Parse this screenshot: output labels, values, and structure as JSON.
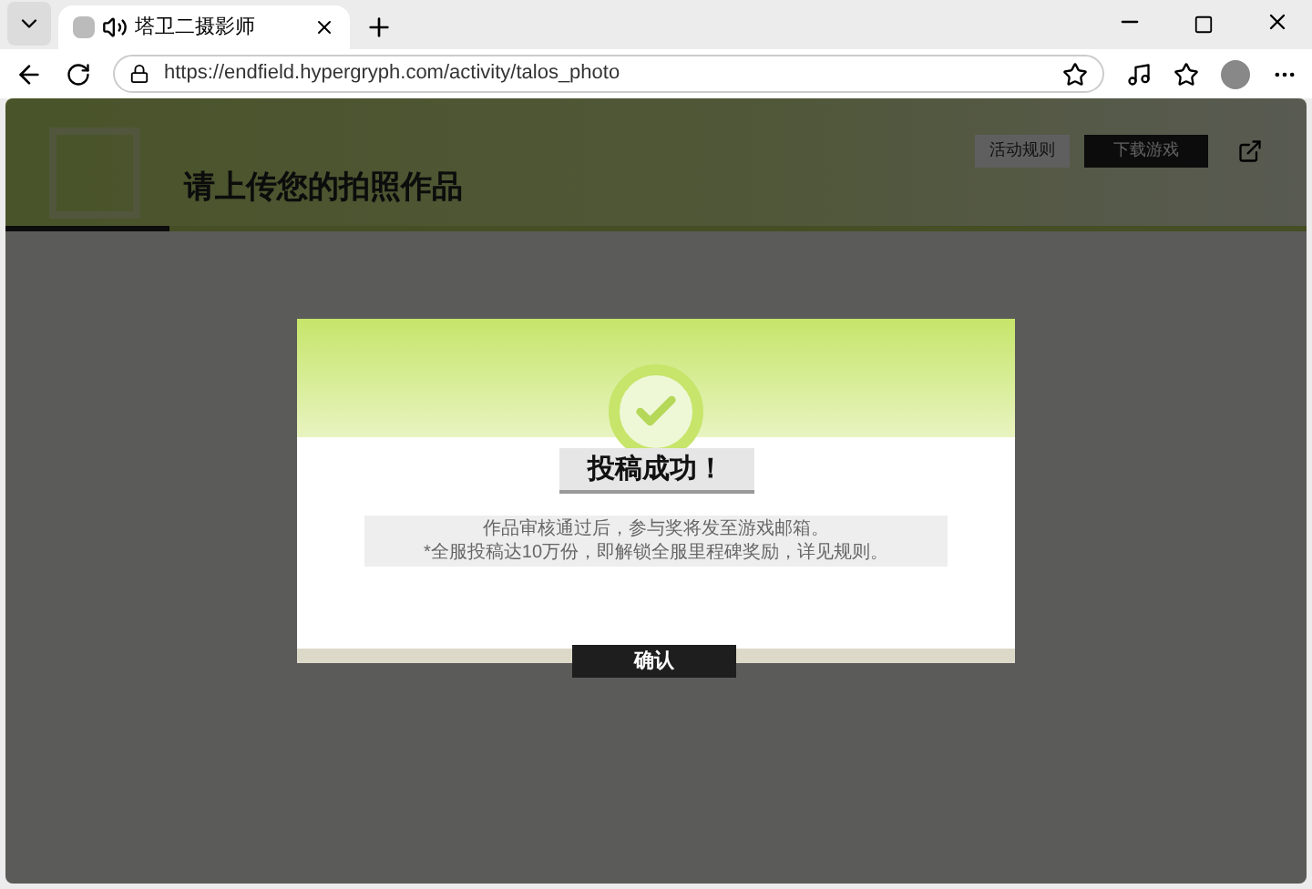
{
  "browser": {
    "tab": {
      "title": "塔卫二摄影师",
      "selected": true
    },
    "url": "https://endfield.hypergryph.com/activity/talos_photo"
  },
  "page": {
    "title": "请上传您的拍照作品",
    "buttons": [
      "活动规则",
      "下载游戏"
    ]
  },
  "dialog": {
    "title": "投稿成功！",
    "lines": [
      "作品审核通过后，参与奖将发至游戏邮箱。",
      "*全服投稿达10万份，即解锁全服里程碑奖励，详见规则。"
    ],
    "confirm": "确认"
  }
}
